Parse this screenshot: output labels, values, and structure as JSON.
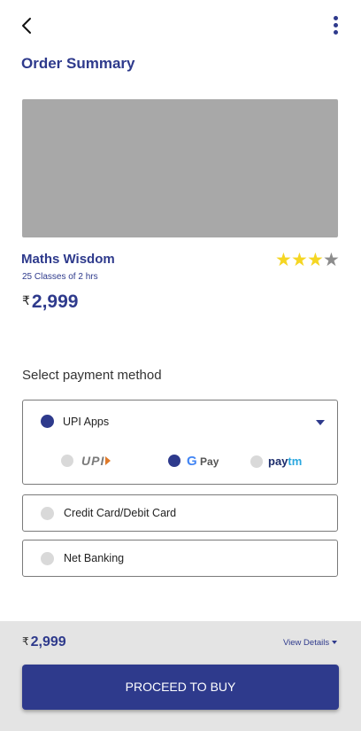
{
  "header": {
    "back_icon": "chevron-left-icon",
    "more_icon": "kebab-menu-icon",
    "title": "Order Summary"
  },
  "course": {
    "name": "Maths Wisdom",
    "subtitle": "25 Classes of 2 hrs",
    "rating": 3,
    "rating_max": 4,
    "currency": "₹",
    "price": "2,999"
  },
  "payment": {
    "heading": "Select payment method",
    "options": [
      {
        "label": "UPI Apps",
        "selected": true,
        "apps": [
          {
            "name": "UPI",
            "selected": false
          },
          {
            "name": "Pay",
            "selected": true
          },
          {
            "name": "paytm",
            "selected": false
          }
        ]
      },
      {
        "label": "Credit Card/Debit Card",
        "selected": false
      },
      {
        "label": "Net Banking",
        "selected": false
      }
    ]
  },
  "footer": {
    "currency": "₹",
    "price": "2,999",
    "view_details": "View Details",
    "cta": "PROCEED TO BUY"
  },
  "colors": {
    "primary": "#2e3a8c",
    "star_on": "#f5d623",
    "star_off": "#8c8c8c",
    "image_placeholder": "#a8a8a8",
    "footer_bg": "#e4e4e4"
  }
}
